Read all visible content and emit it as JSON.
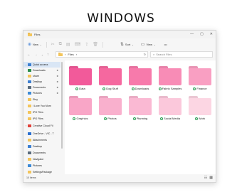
{
  "headline": "WINDOWS",
  "window": {
    "title": "Files",
    "controls": [
      "—",
      "▢",
      "✕"
    ]
  },
  "toolbar": {
    "new_label": "New",
    "sort_label": "Sort",
    "view_label": "View",
    "more": "•••"
  },
  "address": {
    "crumb": "Files",
    "chevron": "›",
    "search_placeholder": "Search Files"
  },
  "sidebar": {
    "items": [
      {
        "label": "Quick access",
        "icon": "star-icon",
        "color": "#3d7fd1",
        "active": true,
        "expand": "⌄",
        "pinned": false
      },
      {
        "label": "Downloads",
        "icon": "download-icon",
        "color": "#2a8c4a",
        "pinned": true
      },
      {
        "label": "share",
        "icon": "folder-icon",
        "color": "#f3c55b",
        "pinned": true
      },
      {
        "label": "Desktop",
        "icon": "desktop-icon",
        "color": "#3d7fd1",
        "pinned": true
      },
      {
        "label": "Documents",
        "icon": "document-icon",
        "color": "#5a6b7c",
        "pinned": true
      },
      {
        "label": "Pictures",
        "icon": "pictures-icon",
        "color": "#3d8ad6",
        "pinned": true
      },
      {
        "label": "Etsy",
        "icon": "folder-icon",
        "color": "#f3c55b",
        "pinned": false
      },
      {
        "label": "I Love You Mom",
        "icon": "folder-icon",
        "color": "#f3c55b",
        "pinned": false
      },
      {
        "label": "IPG Files",
        "icon": "folder-icon",
        "color": "#f3c55b",
        "pinned": false
      },
      {
        "label": "IPG Files",
        "icon": "folder-icon",
        "color": "#f3c55b",
        "pinned": false
      },
      {
        "label": "Creative Cloud Fil",
        "icon": "creative-cloud-icon",
        "color": "#e0413a",
        "expand": "›",
        "pinned": false
      },
      {
        "label": "OneDrive - VIC - T",
        "icon": "onedrive-icon",
        "color": "#2a6fd0",
        "expand": "⌄",
        "pinned": false
      },
      {
        "label": "Attachments",
        "icon": "folder-icon",
        "color": "#f3c55b",
        "pinned": false
      },
      {
        "label": "Desktop",
        "icon": "desktop-icon",
        "color": "#3d7fd1",
        "pinned": false
      },
      {
        "label": "Documents",
        "icon": "document-icon",
        "color": "#5a6b7c",
        "pinned": false
      },
      {
        "label": "Navigator",
        "icon": "folder-icon",
        "color": "#f3c55b",
        "pinned": false
      },
      {
        "label": "Pictures",
        "icon": "pictures-icon",
        "color": "#3d8ad6",
        "pinned": false
      },
      {
        "label": "SettingsPackage",
        "icon": "folder-icon",
        "color": "#f3c55b",
        "pinned": false
      }
    ]
  },
  "folders": [
    {
      "label": "Data",
      "color": "#f25a9a"
    },
    {
      "label": "Dog Stuff",
      "color": "#f5689f"
    },
    {
      "label": "Downloads",
      "color": "#f77aab"
    },
    {
      "label": "Fabric Samples",
      "color": "#f88cb6"
    },
    {
      "label": "Finance",
      "color": "#f99fc2"
    },
    {
      "label": "Graphics",
      "color": "#f9a6c7"
    },
    {
      "label": "Photos",
      "color": "#f9b0cd"
    },
    {
      "label": "Planning",
      "color": "#fab9d3"
    },
    {
      "label": "Social Media",
      "color": "#fbc8db"
    },
    {
      "label": "Work",
      "color": "#fcd6e3"
    }
  ],
  "status": {
    "count": "10 items"
  }
}
